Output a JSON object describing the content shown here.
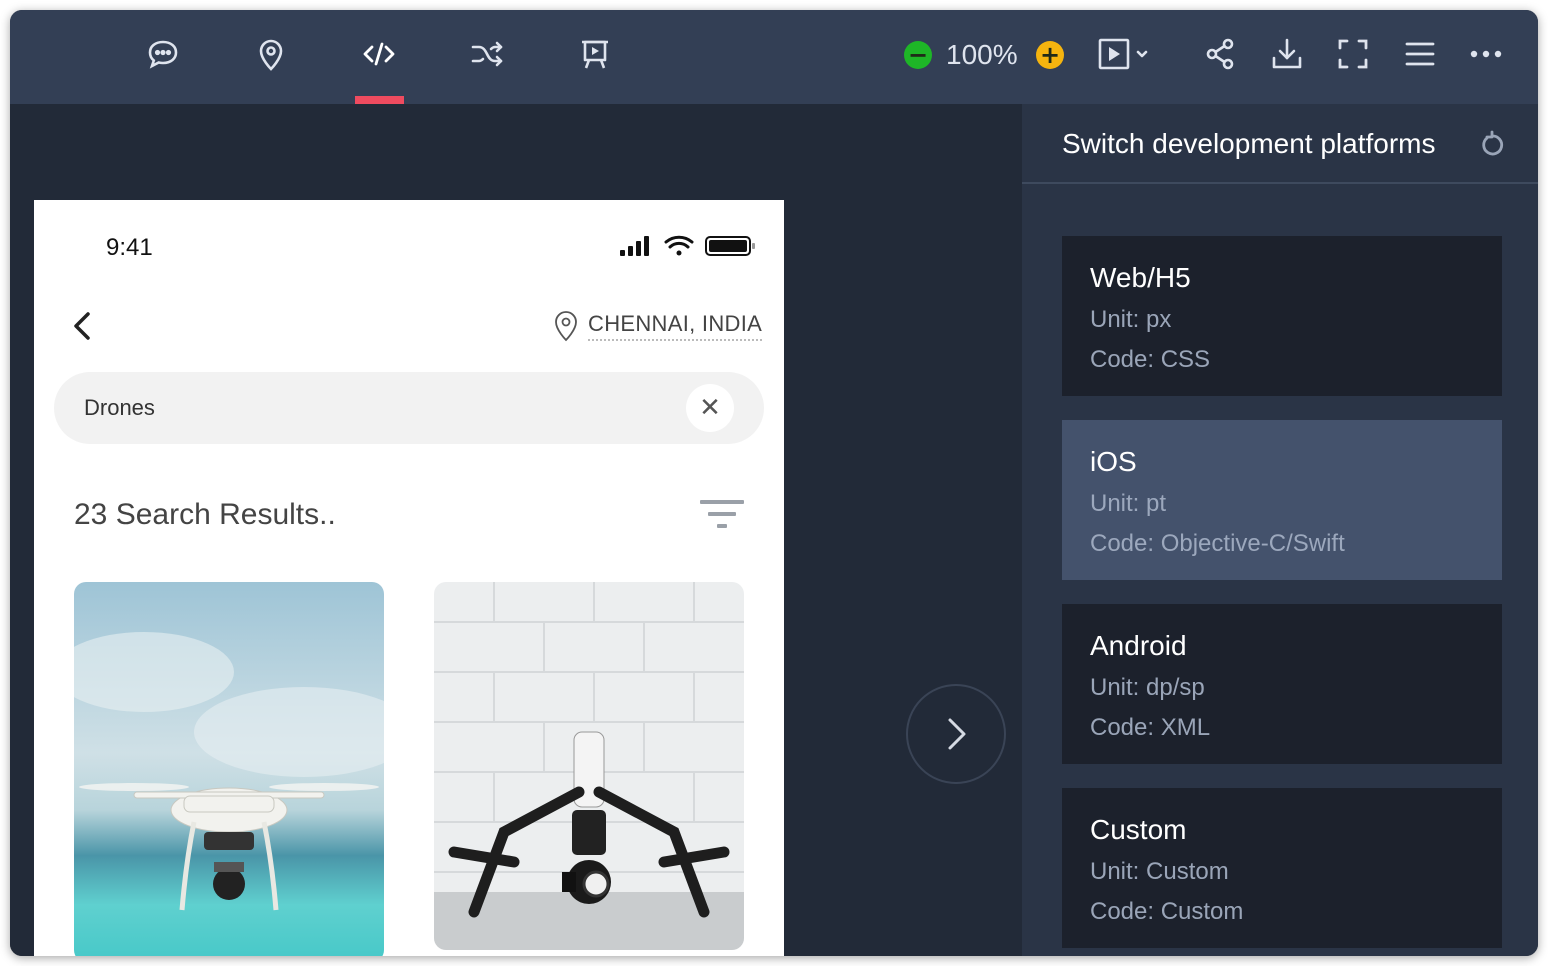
{
  "toolbar": {
    "icons": [
      "comment-icon",
      "location-pin-icon",
      "code-icon",
      "shuffle-icon",
      "presentation-icon"
    ],
    "zoom_level": "100%",
    "right_icons": [
      "play-icon",
      "share-icon",
      "download-icon",
      "fullscreen-icon",
      "menu-icon",
      "more-icon"
    ],
    "accent_color": "#ef4b5f"
  },
  "phone": {
    "status_time": "9:41",
    "location": "CHENNAI, INDIA",
    "search": {
      "value": "Drones",
      "placeholder": ""
    },
    "results_label": "23 Search Results.."
  },
  "panel": {
    "title": "Switch development platforms",
    "platforms": [
      {
        "name": "Web/H5",
        "unit": "Unit: px",
        "code": "Code: CSS",
        "selected": false
      },
      {
        "name": "iOS",
        "unit": "Unit: pt",
        "code": "Code: Objective-C/Swift",
        "selected": true
      },
      {
        "name": "Android",
        "unit": "Unit: dp/sp",
        "code": "Code: XML",
        "selected": false
      },
      {
        "name": "Custom",
        "unit": "Unit: Custom",
        "code": "Code: Custom",
        "selected": false
      }
    ]
  }
}
